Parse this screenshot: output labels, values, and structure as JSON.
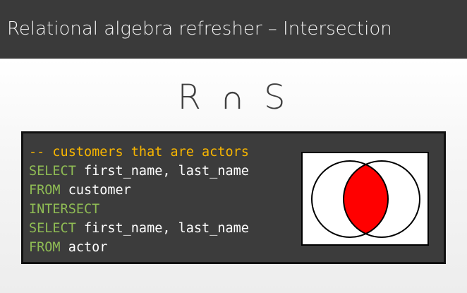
{
  "header": {
    "title": "Relational algebra refresher – Intersection"
  },
  "formula": {
    "left_operand": "R",
    "operator": "∩",
    "right_operand": "S"
  },
  "code": {
    "lines": [
      {
        "parts": [
          {
            "type": "comment",
            "text": "-- customers that are actors"
          }
        ]
      },
      {
        "parts": [
          {
            "type": "keyword",
            "text": "SELECT"
          },
          {
            "type": "text",
            "text": " first_name, last_name"
          }
        ]
      },
      {
        "parts": [
          {
            "type": "keyword",
            "text": "FROM"
          },
          {
            "type": "text",
            "text": " customer"
          }
        ]
      },
      {
        "parts": [
          {
            "type": "keyword",
            "text": "INTERSECT"
          }
        ]
      },
      {
        "parts": [
          {
            "type": "keyword",
            "text": "SELECT"
          },
          {
            "type": "text",
            "text": " first_name, last_name"
          }
        ]
      },
      {
        "parts": [
          {
            "type": "keyword",
            "text": "FROM"
          },
          {
            "type": "text",
            "text": " actor"
          }
        ]
      }
    ]
  },
  "venn": {
    "icon": "venn-intersection-icon",
    "highlight_color": "#ff0000",
    "outline_color": "#000000"
  },
  "colors": {
    "title_bar": "#3a3a3a",
    "code_background": "#3c3c3c",
    "comment": "#f7b500",
    "keyword": "#8fbc54",
    "code_text": "#ffffff"
  }
}
